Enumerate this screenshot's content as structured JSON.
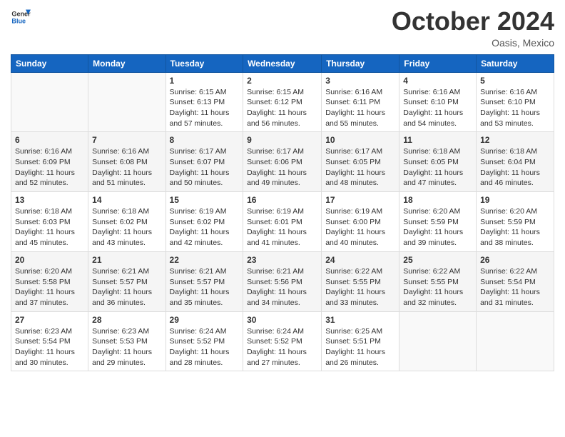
{
  "header": {
    "logo_line1": "General",
    "logo_line2": "Blue",
    "month_title": "October 2024",
    "subtitle": "Oasis, Mexico"
  },
  "weekdays": [
    "Sunday",
    "Monday",
    "Tuesday",
    "Wednesday",
    "Thursday",
    "Friday",
    "Saturday"
  ],
  "weeks": [
    [
      {
        "day": "",
        "sunrise": "",
        "sunset": "",
        "daylight": ""
      },
      {
        "day": "",
        "sunrise": "",
        "sunset": "",
        "daylight": ""
      },
      {
        "day": "1",
        "sunrise": "Sunrise: 6:15 AM",
        "sunset": "Sunset: 6:13 PM",
        "daylight": "Daylight: 11 hours and 57 minutes."
      },
      {
        "day": "2",
        "sunrise": "Sunrise: 6:15 AM",
        "sunset": "Sunset: 6:12 PM",
        "daylight": "Daylight: 11 hours and 56 minutes."
      },
      {
        "day": "3",
        "sunrise": "Sunrise: 6:16 AM",
        "sunset": "Sunset: 6:11 PM",
        "daylight": "Daylight: 11 hours and 55 minutes."
      },
      {
        "day": "4",
        "sunrise": "Sunrise: 6:16 AM",
        "sunset": "Sunset: 6:10 PM",
        "daylight": "Daylight: 11 hours and 54 minutes."
      },
      {
        "day": "5",
        "sunrise": "Sunrise: 6:16 AM",
        "sunset": "Sunset: 6:10 PM",
        "daylight": "Daylight: 11 hours and 53 minutes."
      }
    ],
    [
      {
        "day": "6",
        "sunrise": "Sunrise: 6:16 AM",
        "sunset": "Sunset: 6:09 PM",
        "daylight": "Daylight: 11 hours and 52 minutes."
      },
      {
        "day": "7",
        "sunrise": "Sunrise: 6:16 AM",
        "sunset": "Sunset: 6:08 PM",
        "daylight": "Daylight: 11 hours and 51 minutes."
      },
      {
        "day": "8",
        "sunrise": "Sunrise: 6:17 AM",
        "sunset": "Sunset: 6:07 PM",
        "daylight": "Daylight: 11 hours and 50 minutes."
      },
      {
        "day": "9",
        "sunrise": "Sunrise: 6:17 AM",
        "sunset": "Sunset: 6:06 PM",
        "daylight": "Daylight: 11 hours and 49 minutes."
      },
      {
        "day": "10",
        "sunrise": "Sunrise: 6:17 AM",
        "sunset": "Sunset: 6:05 PM",
        "daylight": "Daylight: 11 hours and 48 minutes."
      },
      {
        "day": "11",
        "sunrise": "Sunrise: 6:18 AM",
        "sunset": "Sunset: 6:05 PM",
        "daylight": "Daylight: 11 hours and 47 minutes."
      },
      {
        "day": "12",
        "sunrise": "Sunrise: 6:18 AM",
        "sunset": "Sunset: 6:04 PM",
        "daylight": "Daylight: 11 hours and 46 minutes."
      }
    ],
    [
      {
        "day": "13",
        "sunrise": "Sunrise: 6:18 AM",
        "sunset": "Sunset: 6:03 PM",
        "daylight": "Daylight: 11 hours and 45 minutes."
      },
      {
        "day": "14",
        "sunrise": "Sunrise: 6:18 AM",
        "sunset": "Sunset: 6:02 PM",
        "daylight": "Daylight: 11 hours and 43 minutes."
      },
      {
        "day": "15",
        "sunrise": "Sunrise: 6:19 AM",
        "sunset": "Sunset: 6:02 PM",
        "daylight": "Daylight: 11 hours and 42 minutes."
      },
      {
        "day": "16",
        "sunrise": "Sunrise: 6:19 AM",
        "sunset": "Sunset: 6:01 PM",
        "daylight": "Daylight: 11 hours and 41 minutes."
      },
      {
        "day": "17",
        "sunrise": "Sunrise: 6:19 AM",
        "sunset": "Sunset: 6:00 PM",
        "daylight": "Daylight: 11 hours and 40 minutes."
      },
      {
        "day": "18",
        "sunrise": "Sunrise: 6:20 AM",
        "sunset": "Sunset: 5:59 PM",
        "daylight": "Daylight: 11 hours and 39 minutes."
      },
      {
        "day": "19",
        "sunrise": "Sunrise: 6:20 AM",
        "sunset": "Sunset: 5:59 PM",
        "daylight": "Daylight: 11 hours and 38 minutes."
      }
    ],
    [
      {
        "day": "20",
        "sunrise": "Sunrise: 6:20 AM",
        "sunset": "Sunset: 5:58 PM",
        "daylight": "Daylight: 11 hours and 37 minutes."
      },
      {
        "day": "21",
        "sunrise": "Sunrise: 6:21 AM",
        "sunset": "Sunset: 5:57 PM",
        "daylight": "Daylight: 11 hours and 36 minutes."
      },
      {
        "day": "22",
        "sunrise": "Sunrise: 6:21 AM",
        "sunset": "Sunset: 5:57 PM",
        "daylight": "Daylight: 11 hours and 35 minutes."
      },
      {
        "day": "23",
        "sunrise": "Sunrise: 6:21 AM",
        "sunset": "Sunset: 5:56 PM",
        "daylight": "Daylight: 11 hours and 34 minutes."
      },
      {
        "day": "24",
        "sunrise": "Sunrise: 6:22 AM",
        "sunset": "Sunset: 5:55 PM",
        "daylight": "Daylight: 11 hours and 33 minutes."
      },
      {
        "day": "25",
        "sunrise": "Sunrise: 6:22 AM",
        "sunset": "Sunset: 5:55 PM",
        "daylight": "Daylight: 11 hours and 32 minutes."
      },
      {
        "day": "26",
        "sunrise": "Sunrise: 6:22 AM",
        "sunset": "Sunset: 5:54 PM",
        "daylight": "Daylight: 11 hours and 31 minutes."
      }
    ],
    [
      {
        "day": "27",
        "sunrise": "Sunrise: 6:23 AM",
        "sunset": "Sunset: 5:54 PM",
        "daylight": "Daylight: 11 hours and 30 minutes."
      },
      {
        "day": "28",
        "sunrise": "Sunrise: 6:23 AM",
        "sunset": "Sunset: 5:53 PM",
        "daylight": "Daylight: 11 hours and 29 minutes."
      },
      {
        "day": "29",
        "sunrise": "Sunrise: 6:24 AM",
        "sunset": "Sunset: 5:52 PM",
        "daylight": "Daylight: 11 hours and 28 minutes."
      },
      {
        "day": "30",
        "sunrise": "Sunrise: 6:24 AM",
        "sunset": "Sunset: 5:52 PM",
        "daylight": "Daylight: 11 hours and 27 minutes."
      },
      {
        "day": "31",
        "sunrise": "Sunrise: 6:25 AM",
        "sunset": "Sunset: 5:51 PM",
        "daylight": "Daylight: 11 hours and 26 minutes."
      },
      {
        "day": "",
        "sunrise": "",
        "sunset": "",
        "daylight": ""
      },
      {
        "day": "",
        "sunrise": "",
        "sunset": "",
        "daylight": ""
      }
    ]
  ]
}
